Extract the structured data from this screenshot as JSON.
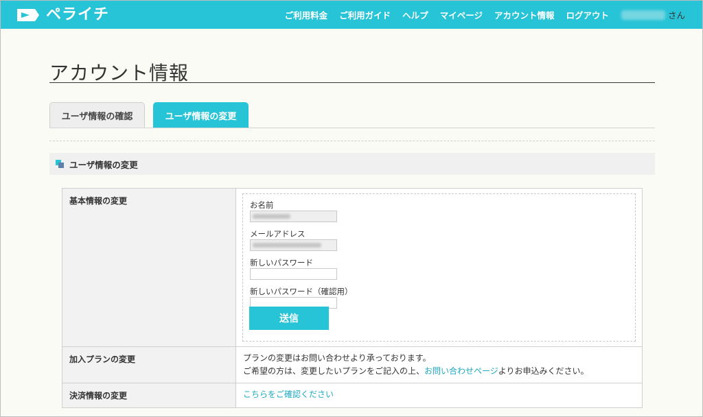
{
  "header": {
    "logo_text": "ペライチ",
    "nav": [
      "ご利用料金",
      "ご利用ガイド",
      "ヘルプ",
      "マイページ",
      "アカウント情報",
      "ログアウト"
    ],
    "user_suffix": "さん",
    "brand_color": "#27c3d6"
  },
  "page": {
    "title": "アカウント情報",
    "tabs": [
      {
        "label": "ユーザ情報の確認",
        "active": false
      },
      {
        "label": "ユーザ情報の変更",
        "active": true
      }
    ],
    "section_title": "ユーザ情報の変更"
  },
  "table": {
    "basic": {
      "label": "基本情報の変更",
      "name_label": "お名前",
      "email_label": "メールアドレス",
      "new_password_label": "新しいパスワード",
      "confirm_password_label": "新しいパスワード（確認用）",
      "submit_label": "送信"
    },
    "plan": {
      "label": "加入プランの変更",
      "line1": "プランの変更はお問い合わせより承っております。",
      "line2_prefix": "ご希望の方は、変更したいプランをご記入の上、",
      "line2_link": "お問い合わせページ",
      "line2_suffix": "よりお申込みください。"
    },
    "payment": {
      "label": "決済情報の変更",
      "link": "こちらをご確認ください"
    }
  }
}
